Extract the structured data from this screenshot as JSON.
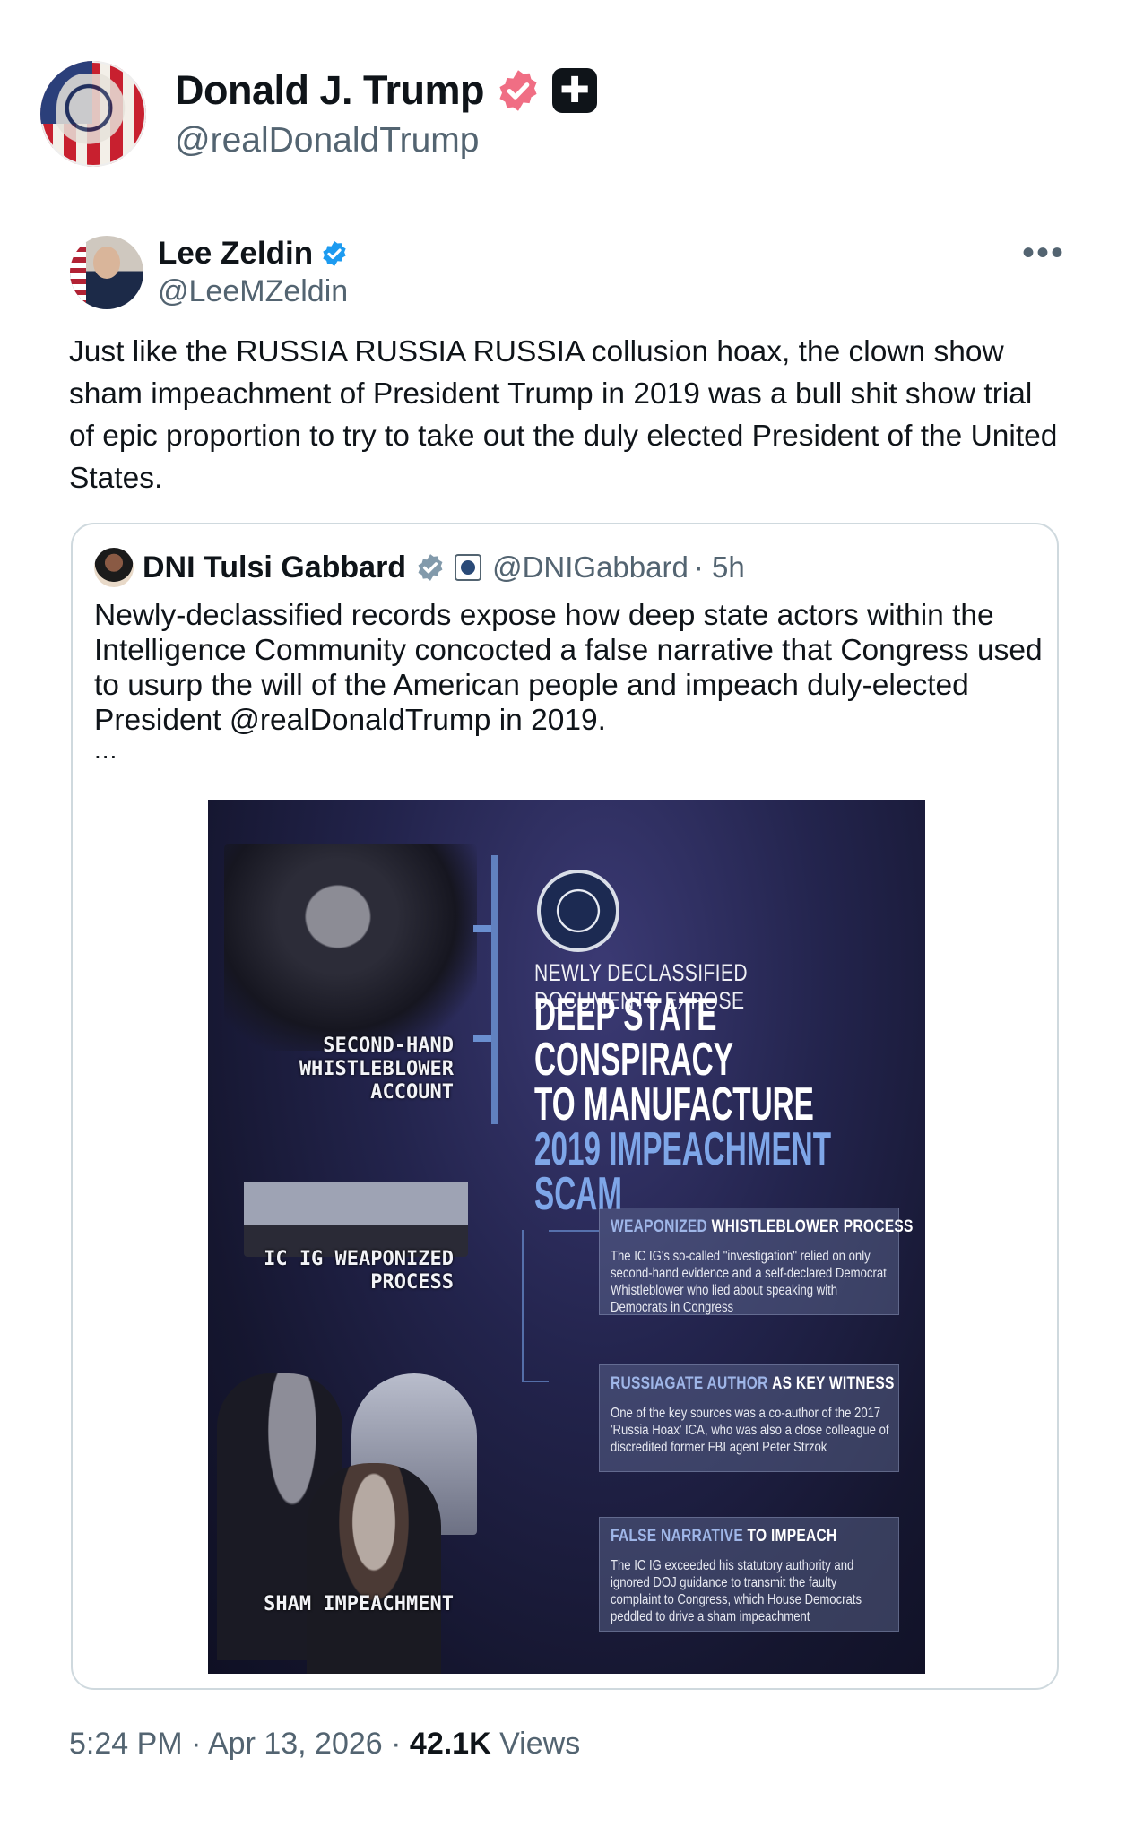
{
  "post": {
    "author_name": "Donald J. Trump",
    "author_handle": "@realDonaldTrump",
    "affiliate_badge_glyph": "✚",
    "timestamp": "5:24 PM",
    "date": "Apr 13, 2026",
    "sep": "·",
    "views_count": "42.1K",
    "views_label": "Views"
  },
  "quoted": {
    "name": "Lee Zeldin",
    "handle": "@LeeMZeldin",
    "more_glyph": "•••",
    "text": "Just like the RUSSIA RUSSIA RUSSIA collusion hoax, the clown show sham impeachment of President Trump in 2019 was a bull shit show trial of epic proportion to try to take out the duly elected President of the United States."
  },
  "inner_quote": {
    "name": "DNI Tulsi Gabbard",
    "handle": "@DNIGabbard",
    "age": "· 5h",
    "text": "Newly-declassified records expose how deep state actors within the Intelligence Community concocted a false narrative that Congress used to usurp the will of the American people and impeach duly-elected President @realDonaldTrump in 2019.",
    "ellipsis": "..."
  },
  "infographic": {
    "label_1": "SECOND-HAND WHISTLEBLOWER ACCOUNT",
    "label_2": "IC IG WEAPONIZED PROCESS",
    "label_3": "SHAM IMPEACHMENT",
    "subheading": "NEWLY DECLASSIFIED DOCUMENTS EXPOSE",
    "heading_1": "DEEP STATE CONSPIRACY",
    "heading_2": "TO MANUFACTURE",
    "heading_3": "2019 IMPEACHMENT",
    "heading_4": "SCAM",
    "box1_title_a": "WEAPONIZED",
    "box1_title_b": "WHISTLEBLOWER PROCESS",
    "box1_body": "The IC IG's so-called \"investigation\" relied on only second-hand evidence and a self-declared Democrat Whistleblower who lied about speaking with Democrats in Congress",
    "box2_title_a": "RUSSIAGATE AUTHOR",
    "box2_title_b": "AS KEY WITNESS",
    "box2_body": "One of the key sources was a co-author of the 2017 'Russia Hoax' ICA, who was also a close colleague of discredited former FBI agent Peter Strzok",
    "box3_title_a": "FALSE NARRATIVE",
    "box3_title_b": "TO IMPEACH",
    "box3_body": "The IC IG exceeded his statutory authority and ignored DOJ guidance to transmit the faulty complaint to Congress, which House Democrats peddled to drive a sham impeachment"
  },
  "colors": {
    "text_primary": "#0f1419",
    "text_secondary": "#536471",
    "verified_blue": "#1d9bf0",
    "gold_badge": "#f4a9b3",
    "card_border": "#cfd9de"
  }
}
